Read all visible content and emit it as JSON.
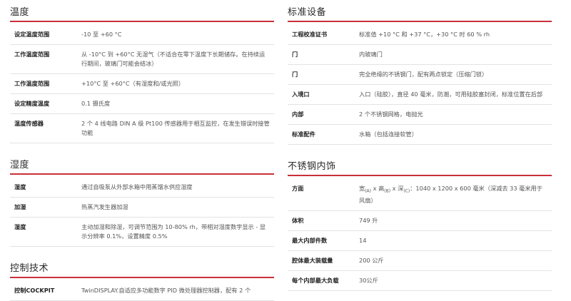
{
  "left": {
    "temperature": {
      "title": "温度",
      "rows": [
        {
          "k": "设定温度范围",
          "v": "-10 至 +60 °C"
        },
        {
          "k": "工作温度范围",
          "v": "从 -10°C 到 +60°C 无湿气（不适合在零下温度下长期储存。在持续运行期间，玻璃门可能会结冰）"
        },
        {
          "k": "工作温度范围",
          "v": "+10°C 至 +60°C（有湿度和/或光照）"
        },
        {
          "k": "设定精度温度",
          "v": "0.1 摄氏度"
        },
        {
          "k": "温度传感器",
          "v": "2 个 4 线电路 DIN A 级 Pt100 传感器用于相互监控，在发生错误时接管功能"
        }
      ]
    },
    "humidity": {
      "title": "湿度",
      "rows": [
        {
          "k": "湿度",
          "v": "通过自吸泵从外部水箱中用蒸馏水供应湿度"
        },
        {
          "k": "加湿",
          "v": "热蒸汽发生器加湿"
        },
        {
          "k": "湿度",
          "v": "主动加湿和除湿，可调节范围为 10-80% rh，带相对湿度数字显示 - 显示分辨率 0.1%，设置精度 0.5%"
        }
      ]
    },
    "control": {
      "title": "控制技术",
      "rows": [
        {
          "k": "控制COCKPIT",
          "v": "TwinDISPLAY.自适应多功能数字 PID 微处理器控制器，配有 2 个"
        }
      ]
    }
  },
  "right": {
    "standard": {
      "title": "标准设备",
      "rows": [
        {
          "k": "工程校准证书",
          "v": "标准值 +10 °C 和 +37 °C，+30 °C 时 60 % rh"
        },
        {
          "k": "门",
          "v": "内玻璃门"
        },
        {
          "k": "门",
          "v": "完全绝缘的不锈钢门，配有两点锁定（压缩门锁）"
        },
        {
          "k": "入境口",
          "v": "入口（硅胶），直径 40 毫米，防潮，可用硅胶塞封闭，标准位置在后部"
        },
        {
          "k": "内部",
          "v": "2 个不锈钢网格，电抛光"
        },
        {
          "k": "标准配件",
          "v": "水箱（包括连接软管）"
        }
      ]
    },
    "interior": {
      "title": "不锈钢内饰",
      "dims": {
        "k": "方面",
        "w": "宽",
        "w_sub": "(A)",
        "h": "高",
        "h_sub": "(B)",
        "d": "深",
        "d_sub": "(C)",
        "rest": "：1040 x 1200 x 600 毫米（深减去 33 毫米用于风扇）",
        "x": " x "
      },
      "rows": [
        {
          "k": "体积",
          "v": "749 升"
        },
        {
          "k": "最大内部件数",
          "v": "14"
        },
        {
          "k": "腔体最大装载量",
          "v": "200 公斤"
        },
        {
          "k": "每个内部最大负载",
          "v": "30公斤"
        }
      ]
    }
  }
}
